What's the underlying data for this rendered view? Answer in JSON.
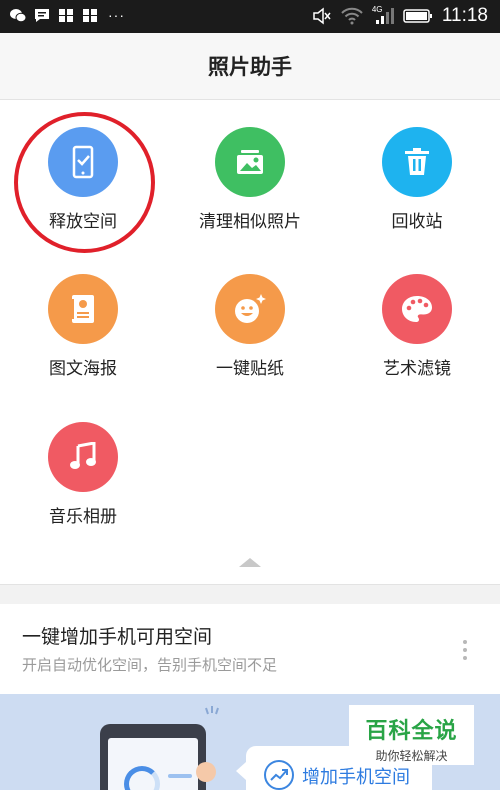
{
  "status_bar": {
    "network": "4G",
    "time": "11:18",
    "left_icons": [
      "wechat-icon",
      "message-icon",
      "app-icon",
      "app-icon"
    ],
    "more": "···"
  },
  "header": {
    "title": "照片助手"
  },
  "tools": [
    {
      "label": "释放空间",
      "icon": "phone-check-icon",
      "color": "#5a9cf0",
      "highlighted": true
    },
    {
      "label": "清理相似照片",
      "icon": "gallery-icon",
      "color": "#3fbf62"
    },
    {
      "label": "回收站",
      "icon": "trash-icon",
      "color": "#1eb3ef"
    },
    {
      "label": "图文海报",
      "icon": "poster-icon",
      "color": "#f59a4a"
    },
    {
      "label": "一键贴纸",
      "icon": "sticker-face-icon",
      "color": "#f59a4a"
    },
    {
      "label": "艺术滤镜",
      "icon": "palette-icon",
      "color": "#f05a63"
    },
    {
      "label": "音乐相册",
      "icon": "music-note-icon",
      "color": "#f05a63"
    }
  ],
  "card": {
    "title": "一键增加手机可用空间",
    "subtitle": "开启自动优化空间，告别手机空间不足"
  },
  "banner": {
    "button_label": "增加手机空间"
  },
  "watermark": {
    "title": "百科全说",
    "subtitle": "助你轻松解决"
  }
}
